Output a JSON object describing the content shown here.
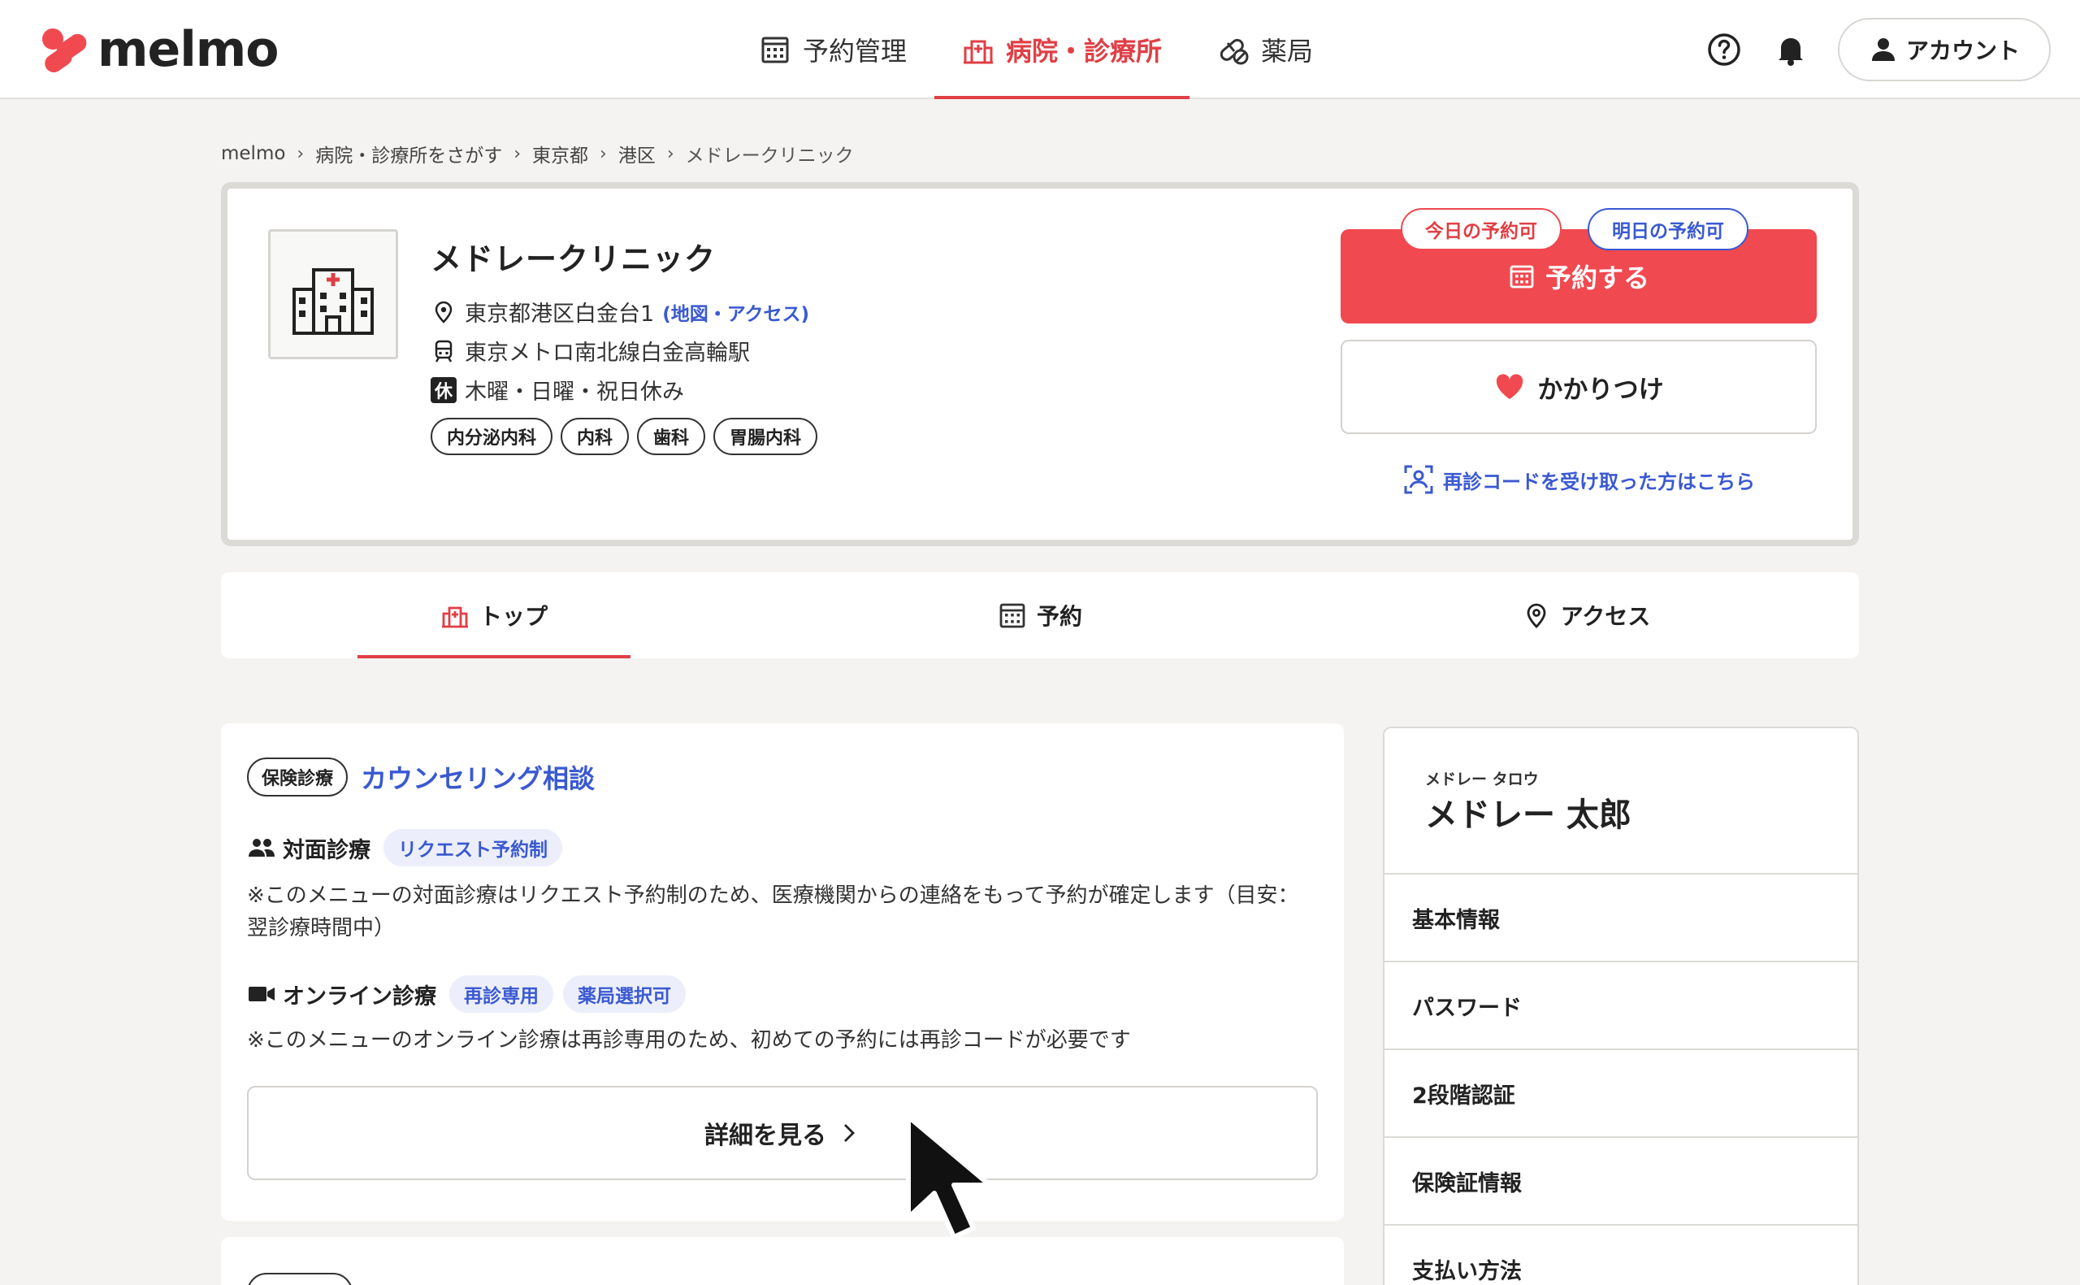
{
  "header": {
    "brand": "melmo",
    "nav": [
      {
        "label": "予約管理",
        "icon": "calendar-icon",
        "active": false
      },
      {
        "label": "病院・診療所",
        "icon": "hospital-icon",
        "active": true
      },
      {
        "label": "薬局",
        "icon": "pill-icon",
        "active": false
      }
    ],
    "account_label": "アカウント"
  },
  "breadcrumb": [
    "melmo",
    "病院・診療所をさがす",
    "東京都",
    "港区",
    "メドレークリニック"
  ],
  "clinic": {
    "name": "メドレークリニック",
    "address": "東京都港区白金台1",
    "map_link": "(地図・アクセス)",
    "station": "東京メトロ南北線白金高輪駅",
    "closed_badge": "休",
    "closed_days": "木曜・日曜・祝日休み",
    "tags": [
      "内分泌内科",
      "内科",
      "歯科",
      "胃腸内科"
    ],
    "today_pill": "今日の予約可",
    "tomorrow_pill": "明日の予約可",
    "reserve_label": "予約する",
    "favorite_label": "かかりつけ",
    "revisit_link": "再診コードを受け取った方はこちら"
  },
  "tabs": [
    {
      "label": "トップ",
      "icon": "hospital-icon",
      "active": true
    },
    {
      "label": "予約",
      "icon": "calendar-icon",
      "active": false
    },
    {
      "label": "アクセス",
      "icon": "map-pin-icon",
      "active": false
    }
  ],
  "menu": {
    "badge": "保険診療",
    "title": "カウンセリング相談",
    "in_person": {
      "label": "対面診療",
      "chips": [
        "リクエスト予約制"
      ],
      "note": "※このメニューの対面診療はリクエスト予約制のため、医療機関からの連絡をもって予約が確定します（目安：翌診療時間中）"
    },
    "online": {
      "label": "オンライン診療",
      "chips": [
        "再診専用",
        "薬局選択可"
      ],
      "note": "※このメニューのオンライン診療は再診専用のため、初めての予約には再診コードが必要です"
    },
    "detail_label": "詳細を見る"
  },
  "sidebar": {
    "name_kana": "メドレー タロウ",
    "name": "メドレー 太郎",
    "items": [
      "基本情報",
      "パスワード",
      "2段階認証",
      "保険証情報",
      "支払い方法"
    ]
  },
  "colors": {
    "brand_red": "#f0494f",
    "link_blue": "#3a59d1",
    "page_bg": "#f4f3f1"
  }
}
